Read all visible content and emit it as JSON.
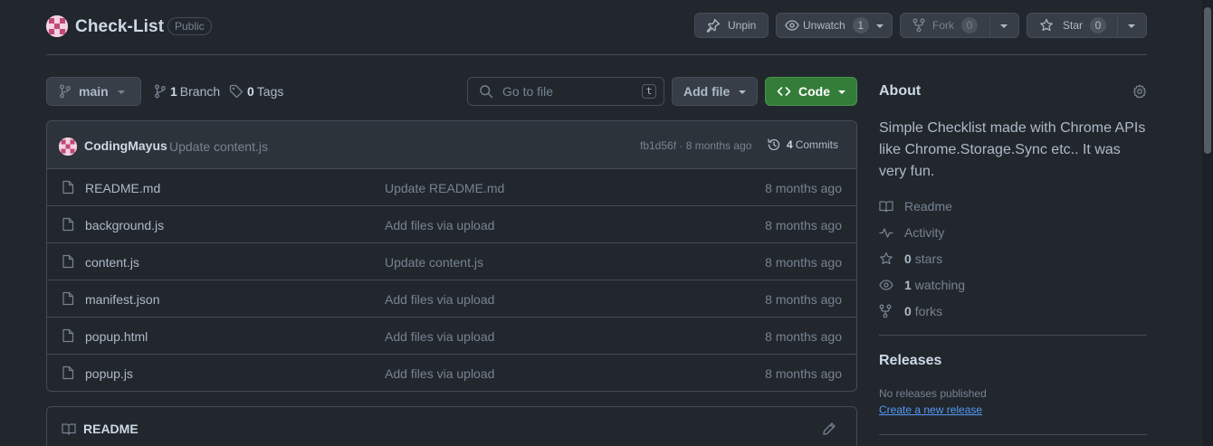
{
  "repo": {
    "name": "Check-List",
    "visibility": "Public"
  },
  "header_actions": {
    "unpin": "Unpin",
    "unwatch": "Unwatch",
    "watch_count": "1",
    "fork": "Fork",
    "fork_count": "0",
    "star": "Star",
    "star_count": "0"
  },
  "toolbar": {
    "branch": "main",
    "branches_count": "1",
    "branches_label": "Branch",
    "tags_count": "0",
    "tags_label": "Tags",
    "search_placeholder": "Go to file",
    "search_shortcut": "t",
    "add_file": "Add file",
    "code": "Code"
  },
  "latest_commit": {
    "author": "CodingMayus",
    "message": "Update content.js",
    "meta": "fb1d56f · 8 months ago",
    "commits_count": "4",
    "commits_label": "Commits"
  },
  "files": [
    {
      "name": "README.md",
      "message": "Update README.md",
      "date": "8 months ago"
    },
    {
      "name": "background.js",
      "message": "Add files via upload",
      "date": "8 months ago"
    },
    {
      "name": "content.js",
      "message": "Update content.js",
      "date": "8 months ago"
    },
    {
      "name": "manifest.json",
      "message": "Add files via upload",
      "date": "8 months ago"
    },
    {
      "name": "popup.html",
      "message": "Add files via upload",
      "date": "8 months ago"
    },
    {
      "name": "popup.js",
      "message": "Add files via upload",
      "date": "8 months ago"
    }
  ],
  "readme": {
    "title": "README"
  },
  "about": {
    "title": "About",
    "description": "Simple Checklist made with Chrome APIs like Chrome.Storage.Sync etc.. It was very fun.",
    "readme": "Readme",
    "activity": "Activity",
    "stars_count": "0",
    "stars_label": "stars",
    "watching_count": "1",
    "watching_label": "watching",
    "forks_count": "0",
    "forks_label": "forks"
  },
  "releases": {
    "title": "Releases",
    "none": "No releases published",
    "create": "Create a new release"
  },
  "colors": {
    "background": "#22272e",
    "border": "#444c56",
    "code_button": "#347d39",
    "link": "#539bf5"
  }
}
